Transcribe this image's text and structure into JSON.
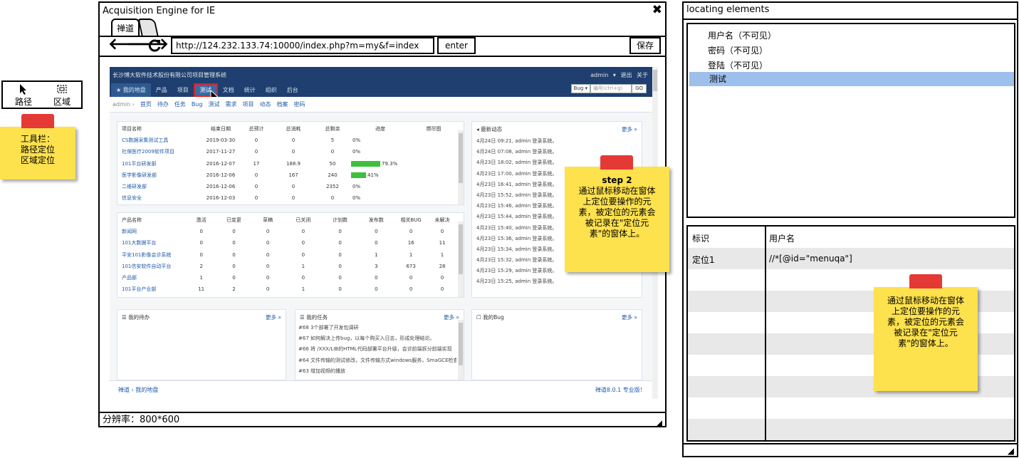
{
  "toolbar": {
    "tools": [
      {
        "label": "路径",
        "icon": "cursor-arrow-icon"
      },
      {
        "label": "区域",
        "icon": "region-select-icon"
      }
    ]
  },
  "note_toolbar": {
    "lines": [
      "工具栏：",
      "路径定位",
      "区域定位"
    ]
  },
  "note_step2": {
    "lines": [
      "step 2",
      "通过鼠标移动在窗体",
      "上定位要操作的元",
      "素，被定位的元素会",
      "被记录在\"定位元",
      "素\"的窗体上。"
    ]
  },
  "note_right": {
    "lines": [
      "通过鼠标移动在窗体",
      "上定位要操作的元",
      "素，被定位的元素会",
      "被记录在\"定位元",
      "素\"的窗体上。"
    ]
  },
  "browser": {
    "title": "Acquisition Engine for IE",
    "close": "✖",
    "tab_label": "禅道",
    "url": "http://124.232.133.74:10000/index.php?m=my&f=index",
    "enter_label": "enter",
    "save_label": "保存",
    "status": "分辨率：800*600",
    "resize": "◢"
  },
  "app": {
    "brand": "长沙博大软件技术股份有限公司项目管理系统",
    "user_menu": "admin ▾  退出  关于",
    "nav_tabs": [
      "我的地盘",
      "产品",
      "项目",
      "测试",
      "文档",
      "统计",
      "组织",
      "后台"
    ],
    "search": {
      "type": "Bug ▾",
      "placeholder": "编号(ctrl+g)",
      "go": "GO"
    },
    "subnav": [
      "admin ›",
      "首页",
      "待办",
      "任务",
      "Bug",
      "测试",
      "需求",
      "项目",
      "动态",
      "档案",
      "密码"
    ],
    "projects": {
      "title": "项目名称",
      "more": "更多 »",
      "headers": [
        "项目名称",
        "结束日期",
        "总预计",
        "总消耗",
        "总剩余",
        "进度",
        "燃尽图"
      ],
      "rows": [
        {
          "name": "CS数据采集测试工具",
          "end": "2019-03-30",
          "est": "0",
          "cons": "0",
          "left": "5",
          "pct": 0,
          "pct_label": "0%"
        },
        {
          "name": "社保医疗2009软件项目",
          "end": "2017-11-27",
          "est": "0",
          "cons": "0",
          "left": "0",
          "pct": 0,
          "pct_label": "0%"
        },
        {
          "name": "101平台研发部",
          "end": "2016-12-07",
          "est": "17",
          "cons": "188.9",
          "left": "50",
          "pct": 79.3,
          "pct_label": "79.3%"
        },
        {
          "name": "医学影像研发部",
          "end": "2016-12-06",
          "est": "0",
          "cons": "167",
          "left": "240",
          "pct": 41,
          "pct_label": "41%"
        },
        {
          "name": "二维研发部",
          "end": "2016-12-06",
          "est": "0",
          "cons": "0",
          "left": "2352",
          "pct": 0,
          "pct_label": "0%"
        },
        {
          "name": "信息安全",
          "end": "2016-12-03",
          "est": "0",
          "cons": "0",
          "left": "0",
          "pct": 0,
          "pct_label": "0%"
        }
      ]
    },
    "products": {
      "headers": [
        "产品名称",
        "激活",
        "已变更",
        "草稿",
        "已关闭",
        "计划数",
        "发布数",
        "相关BUG",
        "未解决"
      ],
      "rows": [
        {
          "name": "新闻网",
          "v": [
            "0",
            "0",
            "0",
            "0",
            "0",
            "0",
            "0",
            "0"
          ]
        },
        {
          "name": "101大数据平台",
          "v": [
            "0",
            "0",
            "0",
            "0",
            "0",
            "0",
            "16",
            "11"
          ]
        },
        {
          "name": "平安101影像会诊系统",
          "v": [
            "0",
            "0",
            "0",
            "0",
            "0",
            "1",
            "1",
            "1"
          ]
        },
        {
          "name": "101信安软件自动平台",
          "v": [
            "2",
            "0",
            "0",
            "1",
            "0",
            "3",
            "673",
            "28"
          ]
        },
        {
          "name": "产品部",
          "v": [
            "1",
            "0",
            "0",
            "0",
            "0",
            "0",
            "0",
            "0"
          ]
        },
        {
          "name": "101平台产业部",
          "v": [
            "11",
            "2",
            "0",
            "1",
            "0",
            "0",
            "0",
            "0"
          ]
        }
      ]
    },
    "feed": {
      "title": "最新动态",
      "more": "更多 »",
      "items": [
        "4月24日 09:21, admin 登录系统。",
        "4月24日 07:08, admin 登录系统。",
        "4月23日 18:02, admin 登录系统。",
        "4月23日 17:00, admin 登录系统。",
        "4月23日 16:41, admin 登录系统。",
        "4月23日 15:52, admin 登录系统。",
        "4月23日 15:46, admin 登录系统。",
        "4月23日 15:44, admin 登录系统。",
        "4月23日 15:40, admin 登录系统。",
        "4月23日 15:36, admin 登录系统。",
        "4月23日 15:34, admin 登录系统。",
        "4月23日 15:32, admin 登录系统。",
        "4月23日 15:29, admin 登录系统。",
        "4月23日 15:25, admin 登录系统。"
      ]
    },
    "todo": {
      "title": "我的待办",
      "more": "更多 »"
    },
    "tasks": {
      "title": "我的任务",
      "more": "更多 »",
      "items": [
        "#68 3个部署了开发包调研",
        "#67 如何解决上传bug，以每个购买入日志，形成处理结论。",
        "#66 将 /XXX/LIB的HTML代码部署平台升级，会诊前端拆分前端实现",
        "#64 文件传输的测试修改，文件传输方式windows服务，SmaGCE检查",
        "#63 增加视频的播放"
      ]
    },
    "bugs": {
      "title": "我的Bug",
      "more": "更多 »"
    },
    "footer": {
      "left": "禅道 ›  我的地盘",
      "right": "禅道8.0.1  专业版!"
    }
  },
  "locating": {
    "title": "locating elements",
    "elements": [
      "用户名（不可见）",
      "密码（不可见）",
      "登陆（不可见）",
      "测试"
    ],
    "selected_index": 3,
    "headers": {
      "id": "标识",
      "name": "用户名"
    },
    "rows": [
      {
        "id": "定位1",
        "xpath": "//*[@id=\"menuqa\"]"
      }
    ],
    "resize": "◢"
  }
}
